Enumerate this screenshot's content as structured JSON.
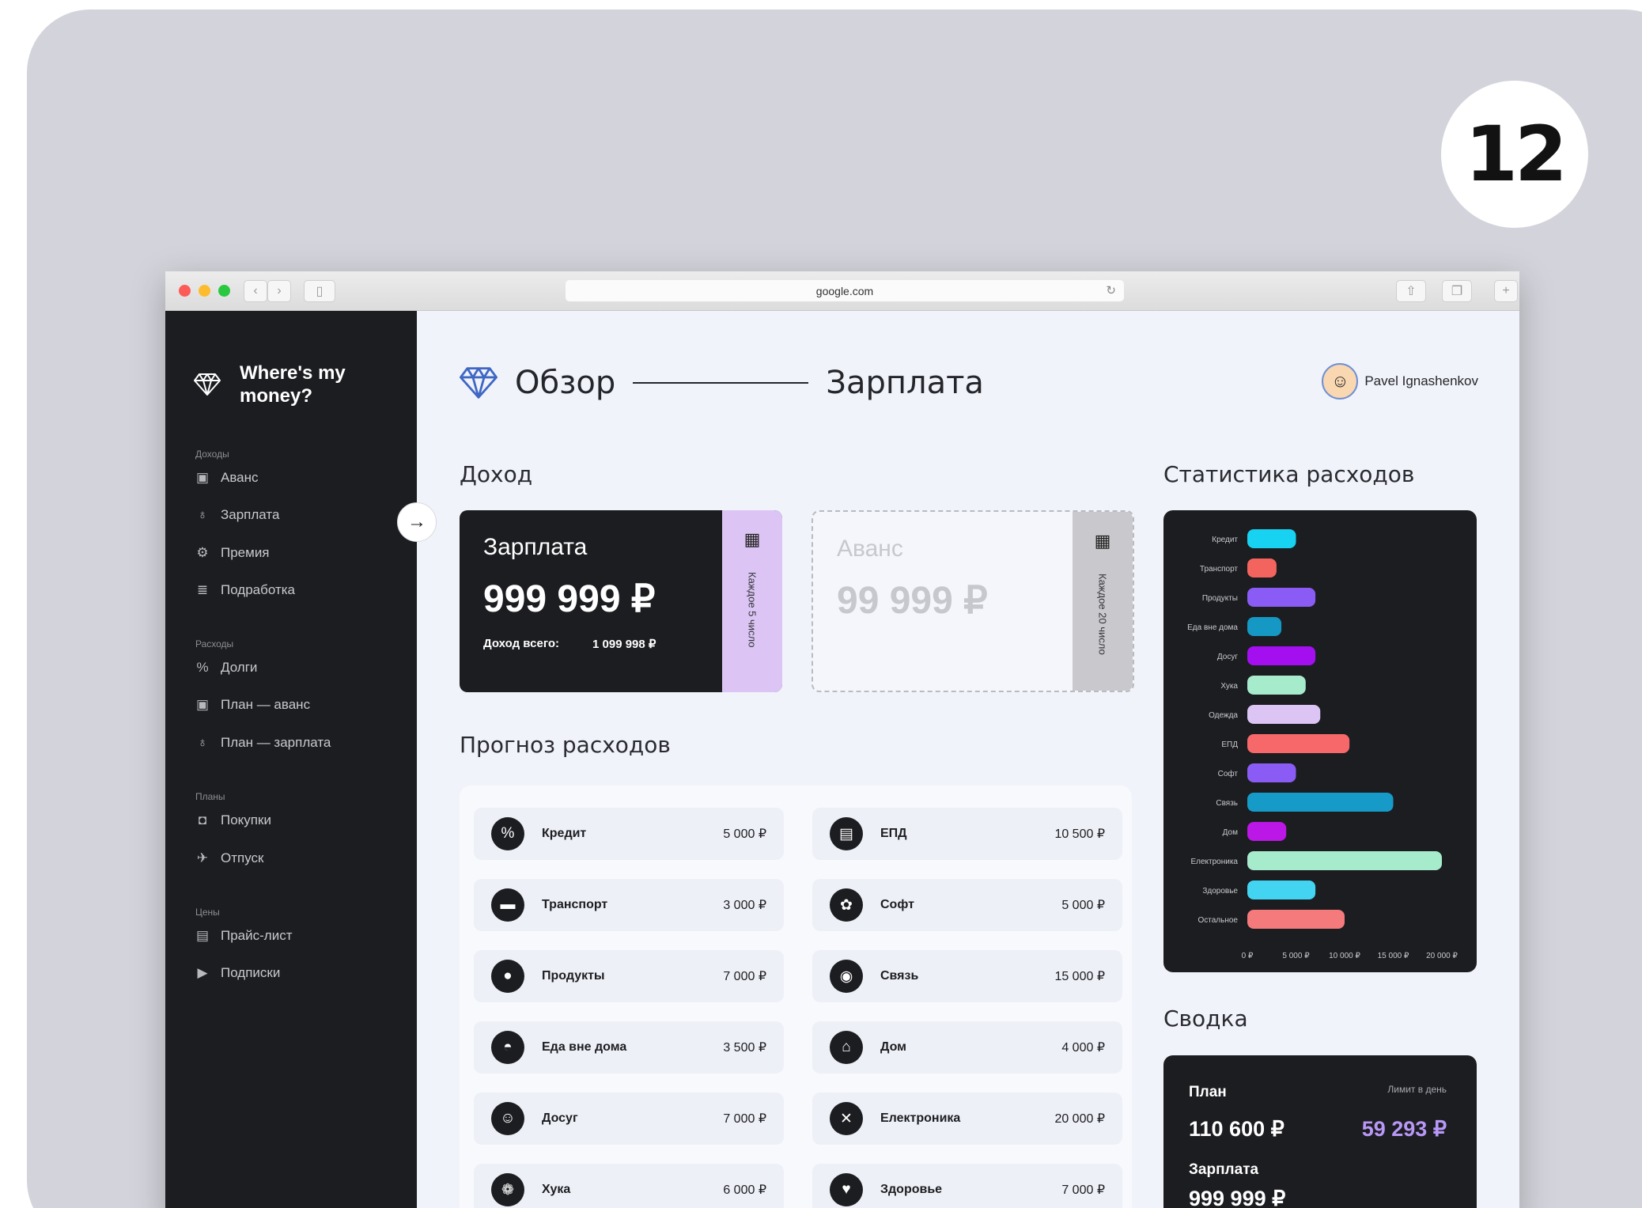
{
  "badge": "12",
  "browser": {
    "url": "google.com"
  },
  "sidebar": {
    "brand": "Where's my money?",
    "sections": [
      {
        "label": "Доходы",
        "items": [
          {
            "label": "Аванс",
            "icon": "banknote-icon"
          },
          {
            "label": "Зарплата",
            "icon": "money-bag-icon"
          },
          {
            "label": "Премия",
            "icon": "gear-icon"
          },
          {
            "label": "Подработка",
            "icon": "coins-icon"
          }
        ]
      },
      {
        "label": "Расходы",
        "items": [
          {
            "label": "Долги",
            "icon": "percent-bag-icon"
          },
          {
            "label": "План — аванс",
            "icon": "banknote-icon"
          },
          {
            "label": "План — зарплата",
            "icon": "money-bag-icon"
          }
        ]
      },
      {
        "label": "Планы",
        "items": [
          {
            "label": "Покупки",
            "icon": "shopping-icon"
          },
          {
            "label": "Отпуск",
            "icon": "plane-icon"
          }
        ]
      },
      {
        "label": "Цены",
        "items": [
          {
            "label": "Прайс-лист",
            "icon": "clipboard-icon"
          },
          {
            "label": "Подписки",
            "icon": "play-icon"
          }
        ]
      }
    ]
  },
  "header": {
    "title": "Обзор",
    "subtitle": "Зарплата",
    "user_name": "Pavel Ignashenkov"
  },
  "income": {
    "section_title": "Доход",
    "salary": {
      "title": "Зарплата",
      "amount": "999 999 ₽",
      "total_label": "Доход всего:",
      "total_value": "1 099 998 ₽",
      "schedule": "Каждое 5 число"
    },
    "advance": {
      "title": "Аванс",
      "amount": "99 999 ₽",
      "schedule": "Каждое 20 число"
    }
  },
  "forecast": {
    "section_title": "Прогноз расходов",
    "left": [
      {
        "name": "Кредит",
        "value": "5 000 ₽",
        "icon": "percent-icon"
      },
      {
        "name": "Транспорт",
        "value": "3 000 ₽",
        "icon": "bus-icon"
      },
      {
        "name": "Продукты",
        "value": "7 000 ₽",
        "icon": "apple-icon"
      },
      {
        "name": "Еда вне дома",
        "value": "3 500 ₽",
        "icon": "burger-icon"
      },
      {
        "name": "Досуг",
        "value": "7 000 ₽",
        "icon": "smile-icon"
      },
      {
        "name": "Хука",
        "value": "6 000 ₽",
        "icon": "paw-icon"
      }
    ],
    "right": [
      {
        "name": "ЕПД",
        "value": "10 500 ₽",
        "icon": "receipt-icon"
      },
      {
        "name": "Софт",
        "value": "5 000 ₽",
        "icon": "flower-icon"
      },
      {
        "name": "Связь",
        "value": "15 000 ₽",
        "icon": "target-icon"
      },
      {
        "name": "Дом",
        "value": "4 000 ₽",
        "icon": "home-icon"
      },
      {
        "name": "Електроника",
        "value": "20 000 ₽",
        "icon": "chip-icon"
      },
      {
        "name": "Здоровье",
        "value": "7 000 ₽",
        "icon": "heart-icon"
      }
    ]
  },
  "stats": {
    "section_title": "Статистика расходов"
  },
  "chart_data": {
    "type": "bar",
    "orientation": "horizontal",
    "categories": [
      "Кредит",
      "Транспорт",
      "Продукты",
      "Еда вне дома",
      "Досуг",
      "Хука",
      "Одежда",
      "ЕПД",
      "Софт",
      "Связь",
      "Дом",
      "Електроника",
      "Здоровье",
      "Остальное"
    ],
    "values": [
      5000,
      3000,
      7000,
      3500,
      7000,
      6000,
      7500,
      10500,
      5000,
      15000,
      4000,
      20000,
      7000,
      10000
    ],
    "colors": [
      "#17d2f0",
      "#f4645f",
      "#8a5cf5",
      "#1598c4",
      "#a40ff0",
      "#a7ebcd",
      "#dcc5f4",
      "#f6686a",
      "#8a5cf5",
      "#169bc9",
      "#bb17e6",
      "#a7ebcd",
      "#43d4f2",
      "#f57a7c"
    ],
    "xlim": [
      0,
      20000
    ],
    "x_ticks": [
      "0 ₽",
      "5 000 ₽",
      "10 000 ₽",
      "15 000 ₽",
      "20 000 ₽"
    ],
    "x_tick_values": [
      0,
      5000,
      10000,
      15000,
      20000
    ],
    "grid": false,
    "background": "#1c1d21"
  },
  "summary": {
    "section_title": "Сводка",
    "plan_label": "План",
    "plan_value": "110 600 ₽",
    "limit_label": "Лимит в день",
    "limit_value": "59 293 ₽",
    "salary_label": "Зарплата",
    "salary_value": "999 999 ₽"
  }
}
